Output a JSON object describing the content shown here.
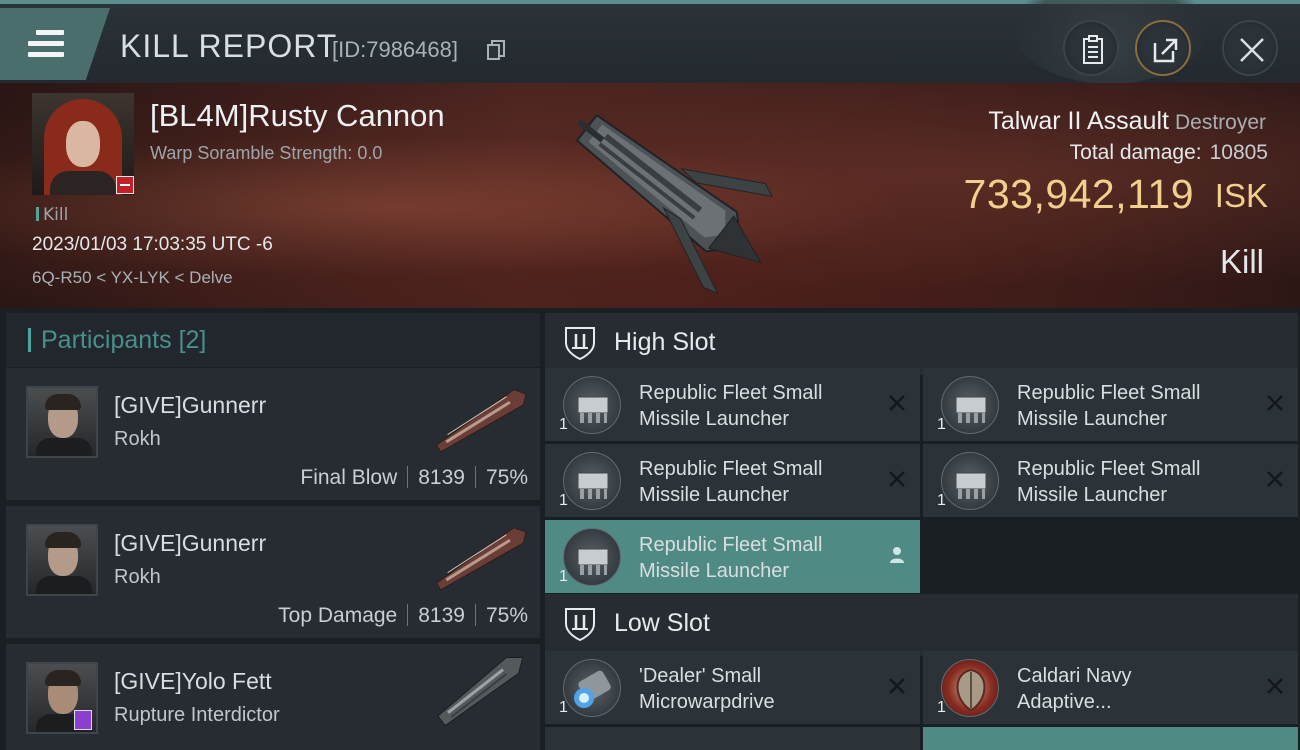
{
  "header": {
    "title": "KILL REPORT",
    "id_label": "[ID:7986468]"
  },
  "victim": {
    "name": "[BL4M]Rusty Cannon",
    "warp_scramble": "Warp Soramble Strength: 0.0",
    "kill_tag": "Kill",
    "datetime": "2023/01/03 17:03:35 UTC -6",
    "location": "6Q-R50 < YX-LYK < Delve",
    "ship_name": "Talwar II Assault",
    "ship_class": "Destroyer",
    "total_damage_label": "Total damage:",
    "total_damage_value": "10805",
    "isk_value": "733,942,119",
    "isk_unit": "ISK",
    "result": "Kill"
  },
  "participants": {
    "title": "Participants",
    "count": "[2]",
    "rows": [
      {
        "name": "[GIVE]Gunnerr",
        "ship": "Rokh",
        "role": "Final Blow",
        "damage": "8139",
        "percent": "75%"
      },
      {
        "name": "[GIVE]Gunnerr",
        "ship": "Rokh",
        "role": "Top Damage",
        "damage": "8139",
        "percent": "75%"
      },
      {
        "name": "[GIVE]Yolo Fett",
        "ship": "Rupture Interdictor"
      }
    ]
  },
  "fitting": {
    "high_slot": {
      "label": "High Slot",
      "modules": [
        {
          "qty": "1",
          "name_line1": "Republic Fleet Small",
          "name_line2": "Missile Launcher"
        },
        {
          "qty": "1",
          "name_line1": "Republic Fleet Small",
          "name_line2": "Missile Launcher"
        },
        {
          "qty": "1",
          "name_line1": "Republic Fleet Small",
          "name_line2": "Missile Launcher"
        },
        {
          "qty": "1",
          "name_line1": "Republic Fleet Small",
          "name_line2": "Missile Launcher"
        },
        {
          "qty": "1",
          "name_line1": "Republic Fleet Small",
          "name_line2": "Missile Launcher"
        }
      ]
    },
    "low_slot": {
      "label": "Low Slot",
      "modules": [
        {
          "qty": "1",
          "name_line1": "'Dealer' Small",
          "name_line2": "Microwarpdrive"
        },
        {
          "qty": "1",
          "name_line1": "Caldari Navy",
          "name_line2": "Adaptive..."
        }
      ]
    }
  },
  "colors": {
    "accent_teal": "#4f8a85",
    "isk_gold": "#f2cf8c",
    "corp_red": "#c4202a"
  }
}
